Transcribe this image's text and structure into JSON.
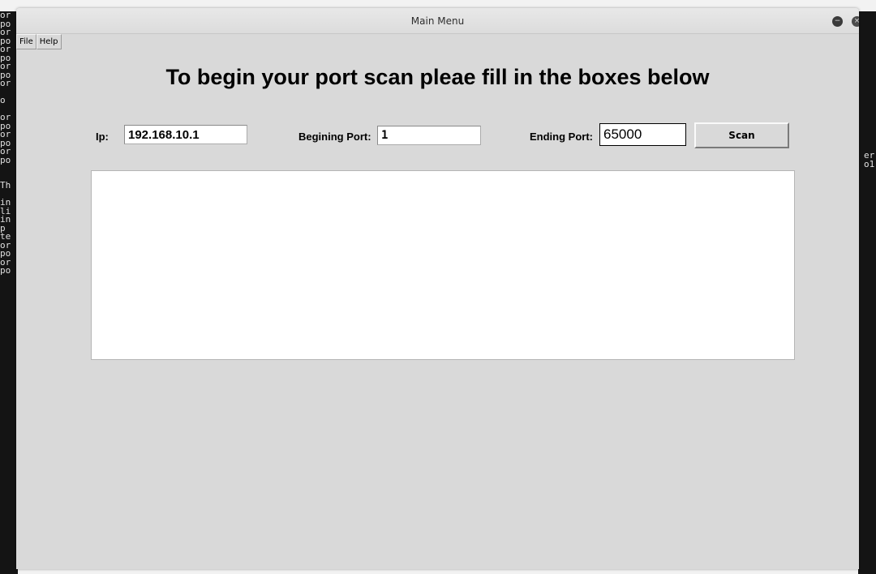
{
  "window": {
    "title": "Main Menu"
  },
  "menu": {
    "items": [
      {
        "label": "File"
      },
      {
        "label": "Help"
      }
    ]
  },
  "form": {
    "heading": "To begin your port scan pleae fill in the boxes below",
    "ip_label": "Ip:",
    "ip_value": "192.168.10.1",
    "begin_label": "Begining Port:",
    "begin_value": "1",
    "end_label": "Ending Port:",
    "end_value": "65000",
    "scan_label": "Scan"
  },
  "output": {
    "text": ""
  },
  "background_terminal": {
    "left_fragments": [
      "or",
      "po",
      "or",
      "po",
      "or",
      "po",
      "or",
      "po",
      "or",
      "",
      "o",
      "",
      "or",
      "po",
      "or",
      "po",
      "or",
      "po",
      "",
      "",
      "Th",
      "",
      "in",
      "li",
      "in",
      "p ",
      "te",
      "or",
      "po",
      "or",
      "po"
    ],
    "right_fragments": [
      "er",
      "o1"
    ]
  },
  "colors": {
    "window_bg": "#d9d9d9",
    "terminal_bg": "#141414"
  }
}
